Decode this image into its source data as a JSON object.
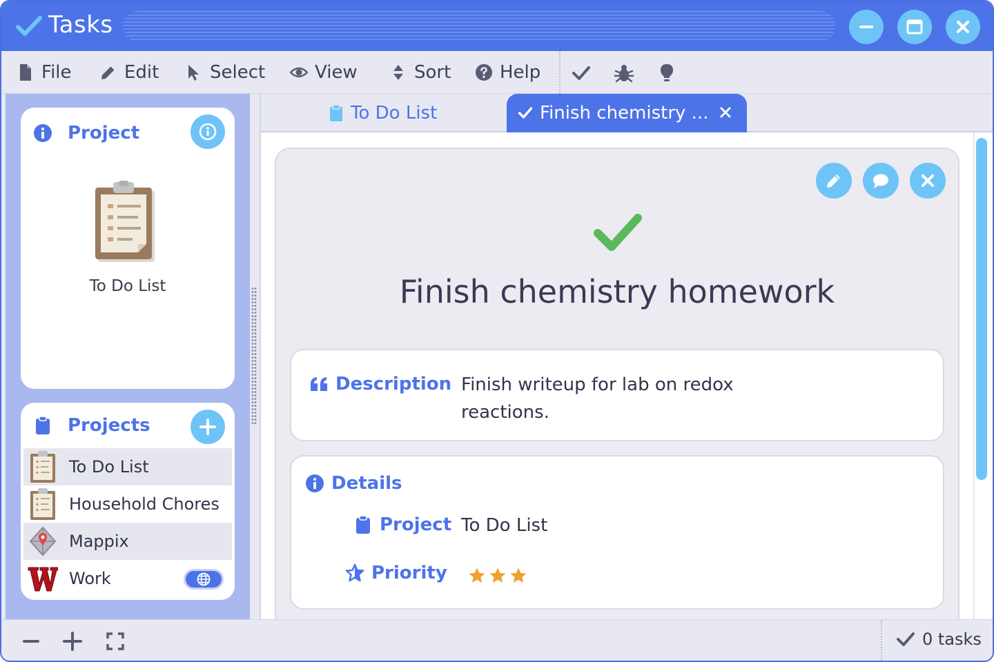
{
  "window": {
    "title": "Tasks",
    "accent": "#4c73e8",
    "button_color": "#6ec4f7",
    "controls": [
      {
        "name": "minimize",
        "icon": "minus-icon"
      },
      {
        "name": "maximize",
        "icon": "window-icon"
      },
      {
        "name": "close",
        "icon": "close-icon"
      }
    ]
  },
  "menu": {
    "items": [
      {
        "label": "File",
        "icon": "file-icon"
      },
      {
        "label": "Edit",
        "icon": "pencil-icon"
      },
      {
        "label": "Select",
        "icon": "cursor-icon"
      },
      {
        "label": "View",
        "icon": "eye-icon"
      },
      {
        "label": "Sort",
        "icon": "sort-icon"
      },
      {
        "label": "Help",
        "icon": "question-icon"
      }
    ],
    "tools": [
      {
        "name": "check",
        "icon": "check-icon"
      },
      {
        "name": "bug",
        "icon": "bug-icon"
      },
      {
        "name": "idea",
        "icon": "lightbulb-icon"
      }
    ]
  },
  "sidebar": {
    "project_card": {
      "title": "Project",
      "project_name": "To Do List",
      "icon": "clipboard-icon"
    },
    "projects_card": {
      "title": "Projects",
      "items": [
        {
          "label": "To Do List",
          "icon": "clipboard-icon"
        },
        {
          "label": "Household Chores",
          "icon": "clipboard-icon"
        },
        {
          "label": "Mappix",
          "icon": "map-pin-icon"
        },
        {
          "label": "Work",
          "icon": "w-logo-icon",
          "toggle_icon": "globe-icon"
        }
      ]
    }
  },
  "tabs": [
    {
      "label": "To Do List",
      "icon": "clipboard-icon"
    },
    {
      "label": "Finish chemistry ...",
      "icon": "check-icon",
      "active": true
    }
  ],
  "task": {
    "title": "Finish chemistry homework",
    "status_icon": "check-icon",
    "status_color": "#5cb85c",
    "actions": [
      {
        "name": "edit",
        "icon": "pencil-icon"
      },
      {
        "name": "comment",
        "icon": "comment-icon"
      },
      {
        "name": "close",
        "icon": "close-icon"
      }
    ],
    "description_label": "Description",
    "description_line1": "Finish writeup for lab on redox",
    "description_line2": "reactions.",
    "details_label": "Details",
    "project_label": "Project",
    "project_value": "To Do List",
    "priority_label": "Priority",
    "priority_stars": 3,
    "star_color": "#f0a030"
  },
  "statusbar": {
    "buttons": [
      {
        "name": "zoom-out",
        "icon": "minus-icon"
      },
      {
        "name": "zoom-in",
        "icon": "plus-icon"
      },
      {
        "name": "fit",
        "icon": "expand-icon"
      }
    ],
    "status_text": "0 tasks"
  }
}
